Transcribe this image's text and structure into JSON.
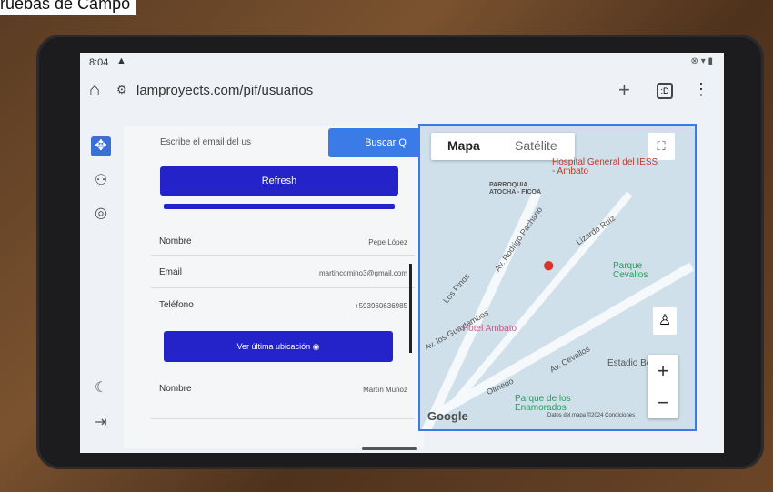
{
  "caption": "ruebas de Campo",
  "status": {
    "time": "8:04",
    "alert_icon": "warning-icon",
    "icons": "⊗ ▾ ▮"
  },
  "browser": {
    "url": "lamproyects.com/pif/usuarios",
    "tab_count": ":D"
  },
  "rail": [
    "dashboard-icon",
    "users-icon",
    "settings-icon",
    "moon-icon",
    "logout-icon"
  ],
  "search": {
    "placeholder": "Escribe el email del us",
    "button": "Buscar Q"
  },
  "refresh": "Refresh",
  "progress_fraction": 1.0,
  "user1": {
    "name_label": "Nombre",
    "name_value": "Pepe López",
    "email_label": "Email",
    "email_value": "martincomino3@gmail.com",
    "phone_label": "Teléfono",
    "phone_value": "+593960636985",
    "loc_button": "Ver última ubicación"
  },
  "user2": {
    "name_label": "Nombre",
    "name_value": "Martín Muñoz"
  },
  "map": {
    "tab_map": "Mapa",
    "tab_sat": "Satélite",
    "labels": {
      "hospital": "Hospital General del IESS - Ambato",
      "parroquia": "PARROQUIA ATOCHA - FICOA",
      "hotel": "Hotel Ambato",
      "parque_cevallos": "Parque Cevallos",
      "estadio": "Estadio Be",
      "parque_enamorados": "Parque de los Enamorados",
      "rodrigo": "Av. Rodrigo Pachano",
      "guaytambos": "Av. los Guaytambos",
      "cevallos": "Av. Cevallos",
      "olmedo": "Olmedo",
      "lizardo": "Lizardo Ruiz",
      "los_pinos": "Los Pinos"
    },
    "google": "Google",
    "attribution": "Datos del mapa ©2024 Condiciones"
  }
}
